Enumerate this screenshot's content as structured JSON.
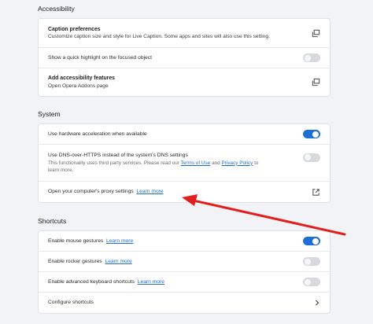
{
  "accessibility": {
    "title": "Accessibility",
    "items": [
      {
        "title": "Caption preferences",
        "subtitle": "Customize caption size and style for Live Caption. Some apps and sites will also use this setting."
      },
      {
        "label": "Show a quick highlight on the focused object",
        "toggle": "off"
      },
      {
        "title": "Add accessibility features",
        "subtitle": "Open Opera Addons page"
      }
    ]
  },
  "system": {
    "title": "System",
    "items": [
      {
        "label": "Use hardware acceleration when available",
        "toggle": "on"
      },
      {
        "label": "Use DNS-over-HTTPS instead of the system's DNS settings",
        "desc_pre": "This functionality uses third party services. Please read our",
        "link1": "Terms of Use",
        "and": "and",
        "link2": "Privacy Policy",
        "desc_post": "to",
        "desc_line2": "learn more.",
        "toggle": "off"
      },
      {
        "label": "Open your computer's proxy settings",
        "link": "Learn more"
      }
    ]
  },
  "shortcuts": {
    "title": "Shortcuts",
    "items": [
      {
        "label": "Enable mouse gestures",
        "link": "Learn more",
        "toggle": "on"
      },
      {
        "label": "Enable rocker gestures",
        "link": "Learn more",
        "toggle": "off"
      },
      {
        "label": "Enable advanced keyboard shortcuts",
        "link": "Learn more",
        "toggle": "off"
      },
      {
        "label": "Configure shortcuts"
      }
    ]
  },
  "colors": {
    "accent": "#1d6ed6",
    "annotation_arrow": "#e0201f"
  },
  "icons": {
    "external": "external-link-icon",
    "open_window": "open-in-new-window-icon",
    "chevron": "chevron-right-icon"
  }
}
